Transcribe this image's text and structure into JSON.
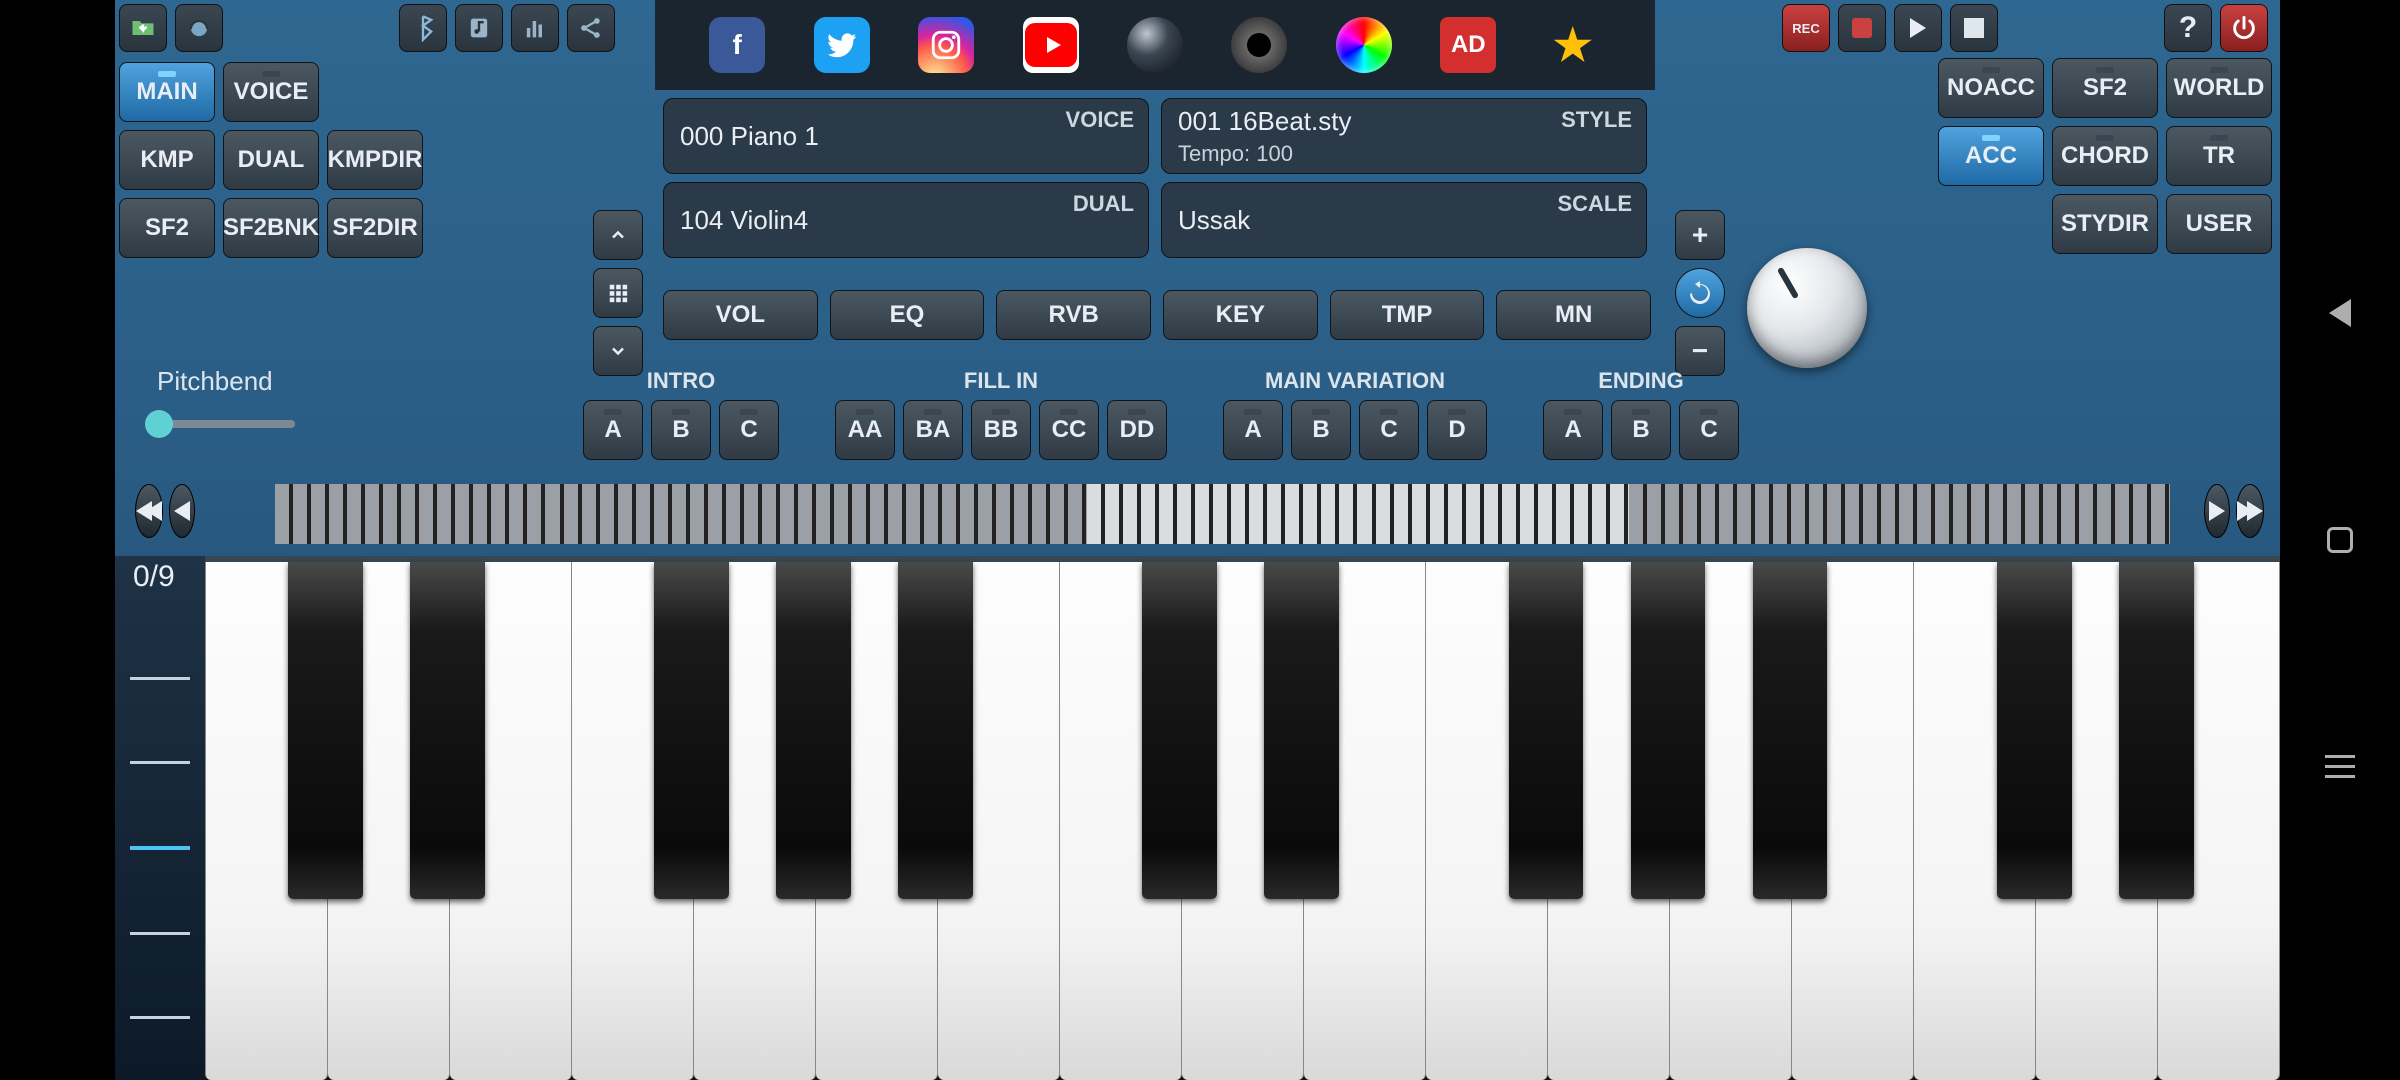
{
  "topLeft": {
    "download": "download-icon",
    "globe": "globe-icon"
  },
  "topMid": {
    "bt": "bluetooth-icon",
    "music": "music-library-icon",
    "stats": "stats-icon",
    "share": "share-icon"
  },
  "transport": {
    "rec": "REC",
    "stop": "■",
    "play": "▶",
    "pause": "⏸",
    "help": "?",
    "power": "⏻"
  },
  "social": {
    "fb": "f",
    "tw": "t",
    "ig": "ig",
    "yt": "yt",
    "globe": "●",
    "gear": "⚙",
    "color": "●",
    "ad": "AD",
    "star": "★"
  },
  "leftGrid": {
    "main": "MAIN",
    "voice": "VOICE",
    "kmp": "KMP",
    "dual": "DUAL",
    "kmpdir": "KMPDIR",
    "sf2": "SF2",
    "sf2bnk": "SF2BNK",
    "sf2dir": "SF2DIR"
  },
  "rightGrid": {
    "noacc": "NOACC",
    "sf2": "SF2",
    "world": "WORLD",
    "acc": "ACC",
    "chord": "CHORD",
    "tr": "TR",
    "stydir": "STYDIR",
    "user": "USER"
  },
  "displays": {
    "voice": {
      "tag": "VOICE",
      "text": "000  Piano 1"
    },
    "dual": {
      "tag": "DUAL",
      "text": "104  Violin4"
    },
    "style": {
      "tag": "STYLE",
      "text": "001 16Beat.sty",
      "sub": "Tempo: 100"
    },
    "scale": {
      "tag": "SCALE",
      "text": "Ussak"
    }
  },
  "ctrls": {
    "vol": "VOL",
    "eq": "EQ",
    "rvb": "RVB",
    "key": "KEY",
    "tmp": "TMP",
    "mn": "MN"
  },
  "arrow": {
    "up": "⌃",
    "grid": "⊞",
    "down": "⌄"
  },
  "pm": {
    "plus": "+",
    "refresh": "↻",
    "minus": "−"
  },
  "pitchbend": "Pitchbend",
  "variations": {
    "intro": {
      "title": "INTRO",
      "buttons": [
        "A",
        "B",
        "C"
      ]
    },
    "fillin": {
      "title": "FILL IN",
      "buttons": [
        "AA",
        "BA",
        "BB",
        "CC",
        "DD"
      ]
    },
    "main": {
      "title": "MAIN VARIATION",
      "buttons": [
        "A",
        "B",
        "C",
        "D"
      ]
    },
    "ending": {
      "title": "ENDING",
      "buttons": [
        "A",
        "B",
        "C"
      ]
    }
  },
  "octave": "0/9",
  "stripNav": {
    "rewind": "⏮",
    "prev": "◀",
    "next": "▶",
    "forward": "⏭"
  }
}
